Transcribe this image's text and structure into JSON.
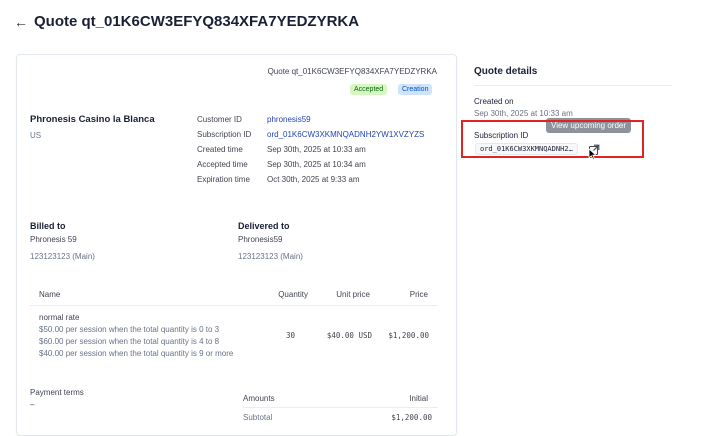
{
  "header": {
    "back_icon": "arrow-left-icon",
    "back_glyph": "←",
    "title": "Quote qt_01K6CW3EFYQ834XFA7YEDZYRKA"
  },
  "quote": {
    "header_id": "Quote qt_01K6CW3EFYQ834XFA7YEDZYRKA",
    "badges": {
      "accepted": "Accepted",
      "creation": "Creation"
    },
    "customer": {
      "name": "Phronesis Casino la Blanca",
      "country": "US"
    },
    "meta": {
      "customer_id_label": "Customer ID",
      "customer_id": "phronesis59",
      "subscription_id_label": "Subscription ID",
      "subscription_id": "ord_01K6CW3XKMNQADNH2YW1XVZYZS",
      "created_label": "Created time",
      "created": "Sep 30th, 2025 at 10:33 am",
      "accepted_label": "Accepted time",
      "accepted": "Sep 30th, 2025 at 10:34 am",
      "expiration_label": "Expiration time",
      "expiration": "Oct 30th, 2025 at 9:33 am"
    },
    "billed_to": {
      "label": "Billed to",
      "name": "Phronesis 59",
      "phone": "123123123 (Main)"
    },
    "delivered_to": {
      "label": "Delivered to",
      "name": "Phronesis59",
      "phone": "123123123 (Main)"
    },
    "table": {
      "headers": {
        "name": "Name",
        "quantity": "Quantity",
        "unit_price": "Unit price",
        "price": "Price"
      },
      "row": {
        "name": "normal rate",
        "tiers": [
          "$50.00 per session when the total quantity is 0 to 3",
          "$60.00 per session when the total quantity is 4 to 8",
          "$40.00 per session when the total quantity is 9 or more"
        ],
        "quantity": "30",
        "unit_price": "$40.00 USD",
        "price": "$1,200.00"
      }
    },
    "payment_terms": {
      "label": "Payment terms",
      "value": "–"
    },
    "amounts": {
      "label": "Amounts",
      "initial_label": "Initial",
      "subtotal_label": "Subtotal",
      "subtotal": "$1,200.00"
    }
  },
  "details": {
    "title": "Quote details",
    "created_label": "Created on",
    "created": "Sep 30th, 2025 at 10:33 am",
    "subscription_label": "Subscription ID",
    "subscription_id": "ord_01K6CW3XKMNQADNH2…",
    "tooltip": "View upcoming order",
    "external_icon": "external-link-icon"
  },
  "colors": {
    "link": "#2345b5",
    "accepted_bg": "#d7f7c2",
    "creation_bg": "#cfe3fb",
    "highlight": "#e02424"
  }
}
